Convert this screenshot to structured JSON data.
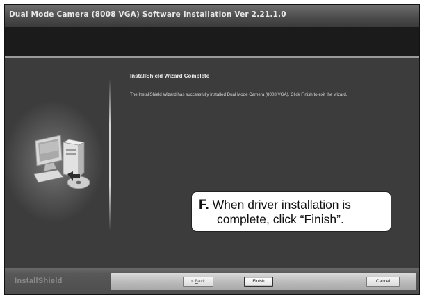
{
  "window": {
    "title": "Dual Mode Camera (8008 VGA) Software Installation Ver 2.21.1.0"
  },
  "wizard": {
    "heading": "InstallShield Wizard Complete",
    "message": "The InstallShield Wizard has successfully installed Dual Mode Camera (8008 VGA).  Click Finish to exit the wizard."
  },
  "callout": {
    "letter": "F.",
    "line1": "When driver installation is",
    "line2": "complete, click “Finish”."
  },
  "footer": {
    "logo": "InstallShield",
    "back_prefix": "< ",
    "back_key": "B",
    "back_rest": "ack",
    "finish_label": "Finish",
    "cancel_label": "Cancel"
  },
  "icons": {
    "computer": "computer-install-icon"
  }
}
